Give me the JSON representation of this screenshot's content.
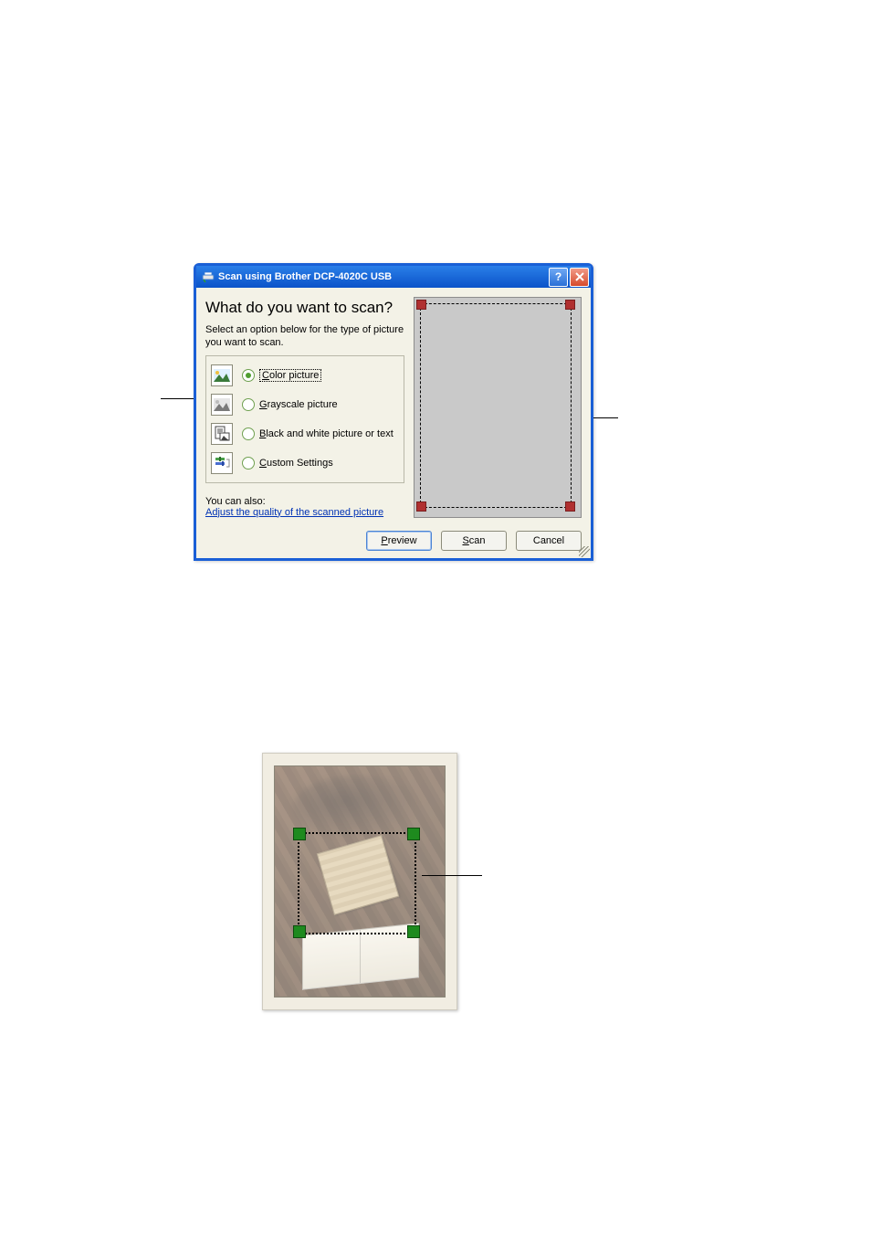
{
  "dialog": {
    "title": "Scan using Brother DCP-4020C USB",
    "heading": "What do you want to scan?",
    "instruction": "Select an option below for the type of picture you want to scan.",
    "options": [
      {
        "label_pre": "C",
        "label_rest": "olor picture",
        "selected": true,
        "icon": "color-photo-icon"
      },
      {
        "label_pre": "G",
        "label_rest": "rayscale picture",
        "selected": false,
        "icon": "gray-photo-icon"
      },
      {
        "label_pre": "B",
        "label_rest": "lack and white picture or text",
        "selected": false,
        "icon": "bw-text-icon"
      },
      {
        "label_pre": "C",
        "label_rest": "ustom Settings",
        "selected": false,
        "icon": "custom-settings-icon"
      }
    ],
    "also_intro": "You can also:",
    "adjust_link": "Adjust the quality of the scanned picture",
    "buttons": {
      "preview_pre": "P",
      "preview_rest": "review",
      "scan_pre": "S",
      "scan_rest": "can",
      "cancel": "Cancel"
    }
  }
}
